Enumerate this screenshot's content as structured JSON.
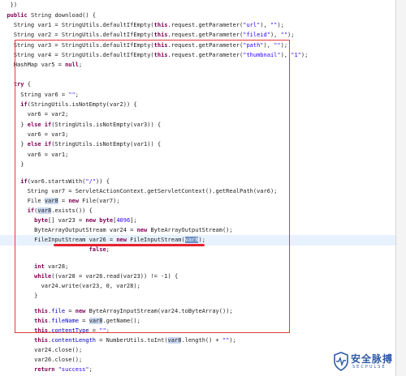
{
  "code": {
    "l1": "})",
    "l2_kw": "public",
    "l2_rest": " String download() {",
    "l3": "String var1 = StringUtils.defaultIfEmpty(",
    "l3_this": "this",
    "l3_mid": ".request.getParameter(",
    "l3_str1": "\"url\"",
    "l3_sep": "), ",
    "l3_str2": "\"\"",
    "l3_end": ");",
    "l4": "String var2 = StringUtils.defaultIfEmpty(",
    "l4_str1": "\"fileid\"",
    "l5": "String var3 = StringUtils.defaultIfEmpty(",
    "l5_str1": "\"path\"",
    "l6": "String var4 = StringUtils.defaultIfEmpty(",
    "l6_str1": "\"thumbnail\"",
    "l6_str2": "\"1\"",
    "l7_a": "HashMap var5 = ",
    "l7_null": "null",
    "l7_b": ";",
    "try_kw": "try",
    "try_brace": " {",
    "l9_a": "String var6 = ",
    "l9_str": "\"\"",
    "l9_b": ";",
    "l10_if": "if",
    "l10_rest": "(StringUtils.isNotEmpty(var2)) {",
    "l11": "var6 = var2;",
    "l12_a": "} ",
    "l12_else": "else if",
    "l12_rest": "(StringUtils.isNotEmpty(var3)) {",
    "l13": "var6 = var3;",
    "l14_rest": "(StringUtils.isNotEmpty(var1)) {",
    "l15": "var6 = var1;",
    "close": "}",
    "l17_if": "if",
    "l17_a": "(var6.startsWith(",
    "l17_str": "\"/\"",
    "l17_b": ")) {",
    "l18": "String var7 = ServletActionContext.getServletContext().getRealPath(var6);",
    "l19_a": "File ",
    "l19_var8": "var8",
    "l19_b": " = ",
    "l19_new": "new",
    "l19_c": " File(var7);",
    "l20_if": "if",
    "l20_a": "(",
    "l20_b": ".exists()) {",
    "l21_byte": "byte",
    "l21_a": "[] var23 = ",
    "l21_new": "new",
    "l21_byte2": "byte",
    "l21_b": "[",
    "l21_num": "4096",
    "l21_c": "];",
    "l22_a": "ByteArrayOutputStream var24 = ",
    "l22_b": " ByteArrayOutputStream();",
    "l23_a": "FileInputStream var26 = ",
    "l23_b": " FileInputStream(",
    "l23_c": ");",
    "l24_hidden": "    ",
    "l24_false": "false",
    "l24_end": ";",
    "l26_int": "int",
    "l26_rest": " var28;",
    "l27_while": "while",
    "l27_rest": "((var28 = var26.read(var23)) != -1) {",
    "l28": "var24.write(var23, 0, var28);",
    "l30_this": "this",
    "l30_a": ".",
    "l30_fld": "file",
    "l30_b": " = ",
    "l30_new": "new",
    "l30_c": " ByteArrayInputStream(var24.toByteArray());",
    "l31_fld": "fileName",
    "l31_c": ".getName();",
    "l32_fld": "contentType",
    "l32_str": "\"\"",
    "l33_fld": "contentLength",
    "l33_a": " = NumberUtils.toInt(",
    "l33_b": ".length() + ",
    "l33_str": "\"\"",
    "l33_c": ");",
    "l34": "var24.close();",
    "l35": "var26.close();",
    "l36_ret": "return",
    "l36_str": "\"success\"",
    "l36_end": ";"
  },
  "watermark": {
    "title": "安全脉搏",
    "subtitle": "SECPULSE"
  },
  "colors": {
    "annotation": "#e33b3b",
    "keyword": "#7f0055",
    "string": "#2a00ff",
    "field": "#0000c0",
    "brand": "#2d5aa6"
  }
}
